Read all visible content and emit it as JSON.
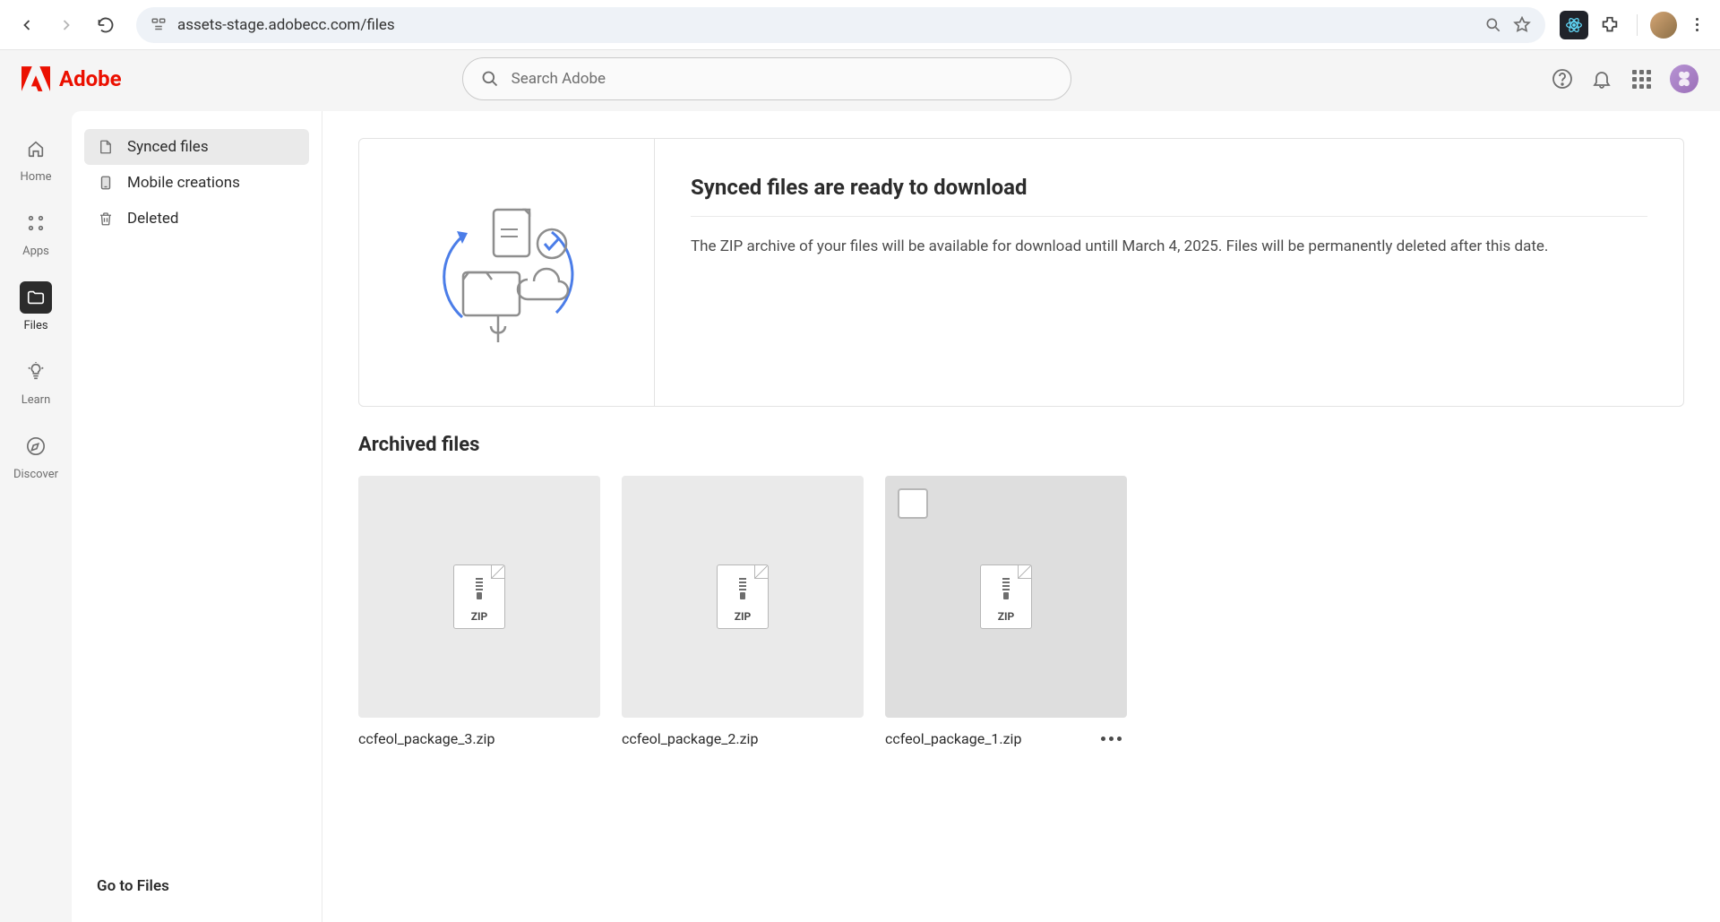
{
  "browser": {
    "url": "assets-stage.adobecc.com/files"
  },
  "brand": "Adobe",
  "search": {
    "placeholder": "Search Adobe"
  },
  "leftRail": [
    {
      "label": "Home",
      "id": "home",
      "active": false
    },
    {
      "label": "Apps",
      "id": "apps",
      "active": false
    },
    {
      "label": "Files",
      "id": "files",
      "active": true
    },
    {
      "label": "Learn",
      "id": "learn",
      "active": false
    },
    {
      "label": "Discover",
      "id": "discover",
      "active": false
    }
  ],
  "innerSidebar": {
    "items": [
      {
        "label": "Synced files",
        "id": "synced",
        "active": true
      },
      {
        "label": "Mobile creations",
        "id": "mobile",
        "active": false
      },
      {
        "label": "Deleted",
        "id": "deleted",
        "active": false
      }
    ],
    "footerLink": "Go to Files"
  },
  "banner": {
    "title": "Synced files are ready to download",
    "description": "The ZIP archive of your files will be available for download untill March 4, 2025. Files will be permanently deleted after this date."
  },
  "archived": {
    "heading": "Archived files",
    "files": [
      {
        "name": "ccfeol_package_3.zip",
        "type": "ZIP",
        "hovered": false
      },
      {
        "name": "ccfeol_package_2.zip",
        "type": "ZIP",
        "hovered": false
      },
      {
        "name": "ccfeol_package_1.zip",
        "type": "ZIP",
        "hovered": true
      }
    ]
  }
}
